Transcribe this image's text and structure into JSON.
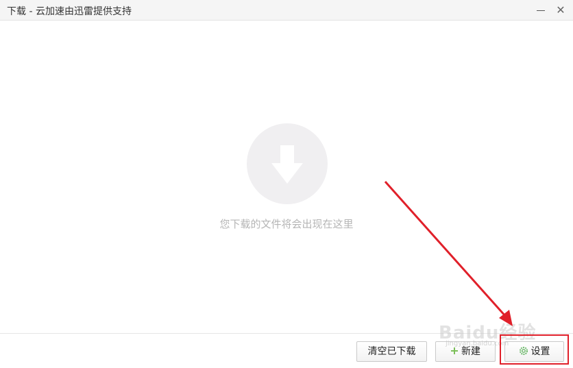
{
  "window": {
    "title": "下载 - 云加速由迅雷提供支持",
    "minimize_icon": "minimize-icon",
    "close_icon": "close-icon",
    "close_glyph": "✕"
  },
  "empty_state": {
    "icon": "download-arrow-icon",
    "message": "您下载的文件将会出现在这里"
  },
  "footer": {
    "clear_label": "清空已下载",
    "new_label": "新建",
    "new_icon": "plus-icon",
    "settings_label": "设置",
    "settings_icon": "gear-icon"
  },
  "annotation": {
    "color": "#e0202a"
  },
  "watermark": {
    "text": "Baidu经验",
    "sub": "jingyan.baidu.com"
  }
}
